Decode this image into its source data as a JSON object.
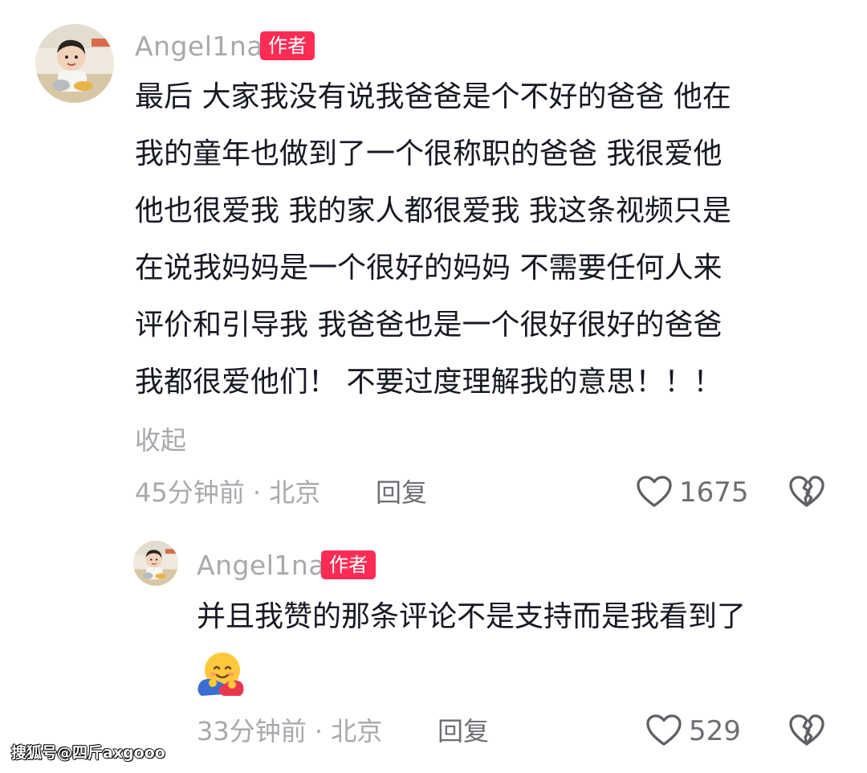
{
  "comment": {
    "username": "Angel1na",
    "author_badge": "作者",
    "text_lines": [
      "最后 大家我没有说我爸爸是个不好的爸爸 他在",
      "我的童年也做到了一个很称职的爸爸 我很爱他",
      "他也很爱我 我的家人都很爱我 我这条视频只是",
      "在说我妈妈是一个很好的妈妈 不需要任何人来",
      "评价和引导我 我爸爸也是一个很好很好的爸爸",
      "我都很爱他们！ 不要过度理解我的意思！！！"
    ],
    "collapse_label": "收起",
    "time_location": "45分钟前 · 北京",
    "reply_label": "回复",
    "like_count": "1675",
    "avatar_icon": "avatar-child-photo"
  },
  "reply": {
    "username": "Angel1na",
    "author_badge": "作者",
    "text": "并且我赞的那条评论不是支持而是我看到了",
    "emoji": "hugging-face-sticker",
    "time_location": "33分钟前 · 北京",
    "reply_label": "回复",
    "like_count": "529",
    "avatar_icon": "avatar-child-photo"
  },
  "watermark": "搜狐号@四斤axgooo",
  "colors": {
    "accent": "#fe2c55",
    "text_primary": "#161823",
    "text_secondary": "#a8a8ad",
    "icon_gray": "#6e6e74"
  }
}
